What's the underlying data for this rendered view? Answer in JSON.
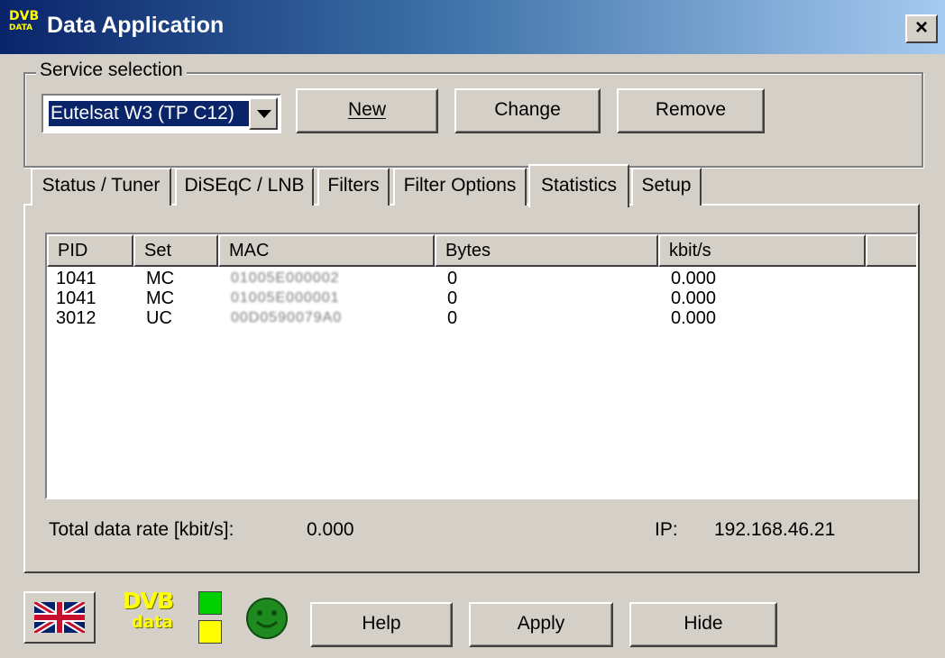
{
  "window": {
    "title": "Data Application",
    "logo_top": "DVB",
    "logo_bottom": "DATA",
    "close_label": "×"
  },
  "service": {
    "group_label": "Service selection",
    "selected": "Eutelsat W3 (TP C12)",
    "buttons": {
      "new": "New",
      "change": "Change",
      "remove": "Remove"
    }
  },
  "tabs": [
    {
      "label": "Status / Tuner"
    },
    {
      "label": "DiSEqC / LNB"
    },
    {
      "label": "Filters"
    },
    {
      "label": "Filter Options"
    },
    {
      "label": "Statistics",
      "active": true
    },
    {
      "label": "Setup"
    }
  ],
  "table": {
    "columns": [
      "PID",
      "Set",
      "MAC",
      "Bytes",
      "kbit/s"
    ],
    "rows": [
      [
        "1041",
        "MC",
        "01005E000002",
        "0",
        "0.000"
      ],
      [
        "1041",
        "MC",
        "01005E000001",
        "0",
        "0.000"
      ],
      [
        "3012",
        "UC",
        "00D0590079A0",
        "0",
        "0.000"
      ]
    ]
  },
  "stats": {
    "total_label": "Total data rate [kbit/s]:",
    "total_value": "0.000",
    "ip_label": "IP:",
    "ip_value": "192.168.46.21"
  },
  "bottom": {
    "logo_l1": "DVB",
    "logo_l2": "data",
    "help": "Help",
    "apply": "Apply",
    "hide": "Hide"
  },
  "colors": {
    "title_start": "#0a246a",
    "title_end": "#a6caf0",
    "face": "#d4d0c8",
    "selection": "#0a246a",
    "led_green": "#00d000",
    "led_yellow": "#ffff00",
    "smiley": "#1f8a1f"
  }
}
